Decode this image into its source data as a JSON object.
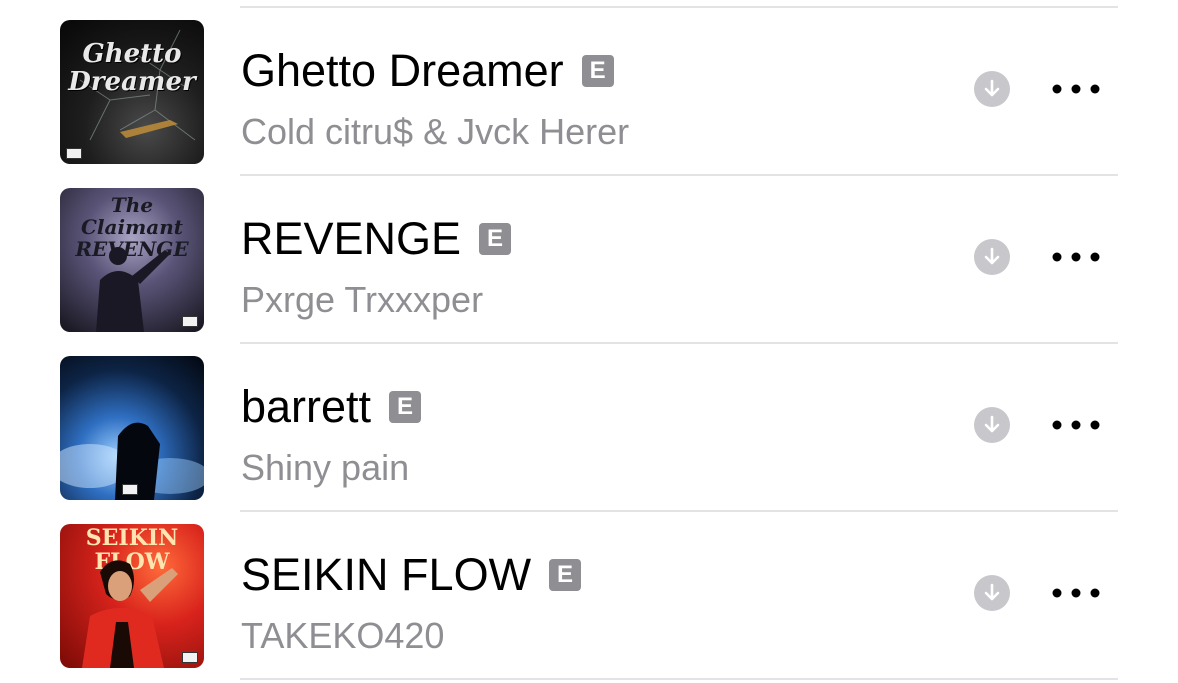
{
  "songs": [
    {
      "title": "Ghetto Dreamer",
      "artist": "Cold citru$ & Jvck Herer",
      "explicit_label": "E",
      "artwork_text": "Ghetto Dreamer",
      "artwork_colors": [
        "#2a2a2a",
        "#0d0d0d"
      ]
    },
    {
      "title": "REVENGE",
      "artist": "Pxrge Trxxxper",
      "explicit_label": "E",
      "artwork_text": "The Claimant REVENGE",
      "artwork_colors": [
        "#6e6a8c",
        "#141218"
      ]
    },
    {
      "title": "barrett",
      "artist": "Shiny pain",
      "explicit_label": "E",
      "artwork_text": "",
      "artwork_colors": [
        "#1d4c8a",
        "#050a14"
      ]
    },
    {
      "title": "SEIKIN FLOW",
      "artist": "TAKEKO420",
      "explicit_label": "E",
      "artwork_text": "SEIKIN FLOW",
      "artwork_colors": [
        "#d8231c",
        "#6b0806"
      ]
    }
  ],
  "icons": {
    "download": "download-arrow-icon",
    "more": "ellipsis-icon",
    "explicit": "explicit-badge"
  },
  "colors": {
    "secondary_text": "#8e8e93",
    "badge": "#8e8e93",
    "download_circle": "#c7c7cc",
    "separator": "#e3e3e5"
  }
}
